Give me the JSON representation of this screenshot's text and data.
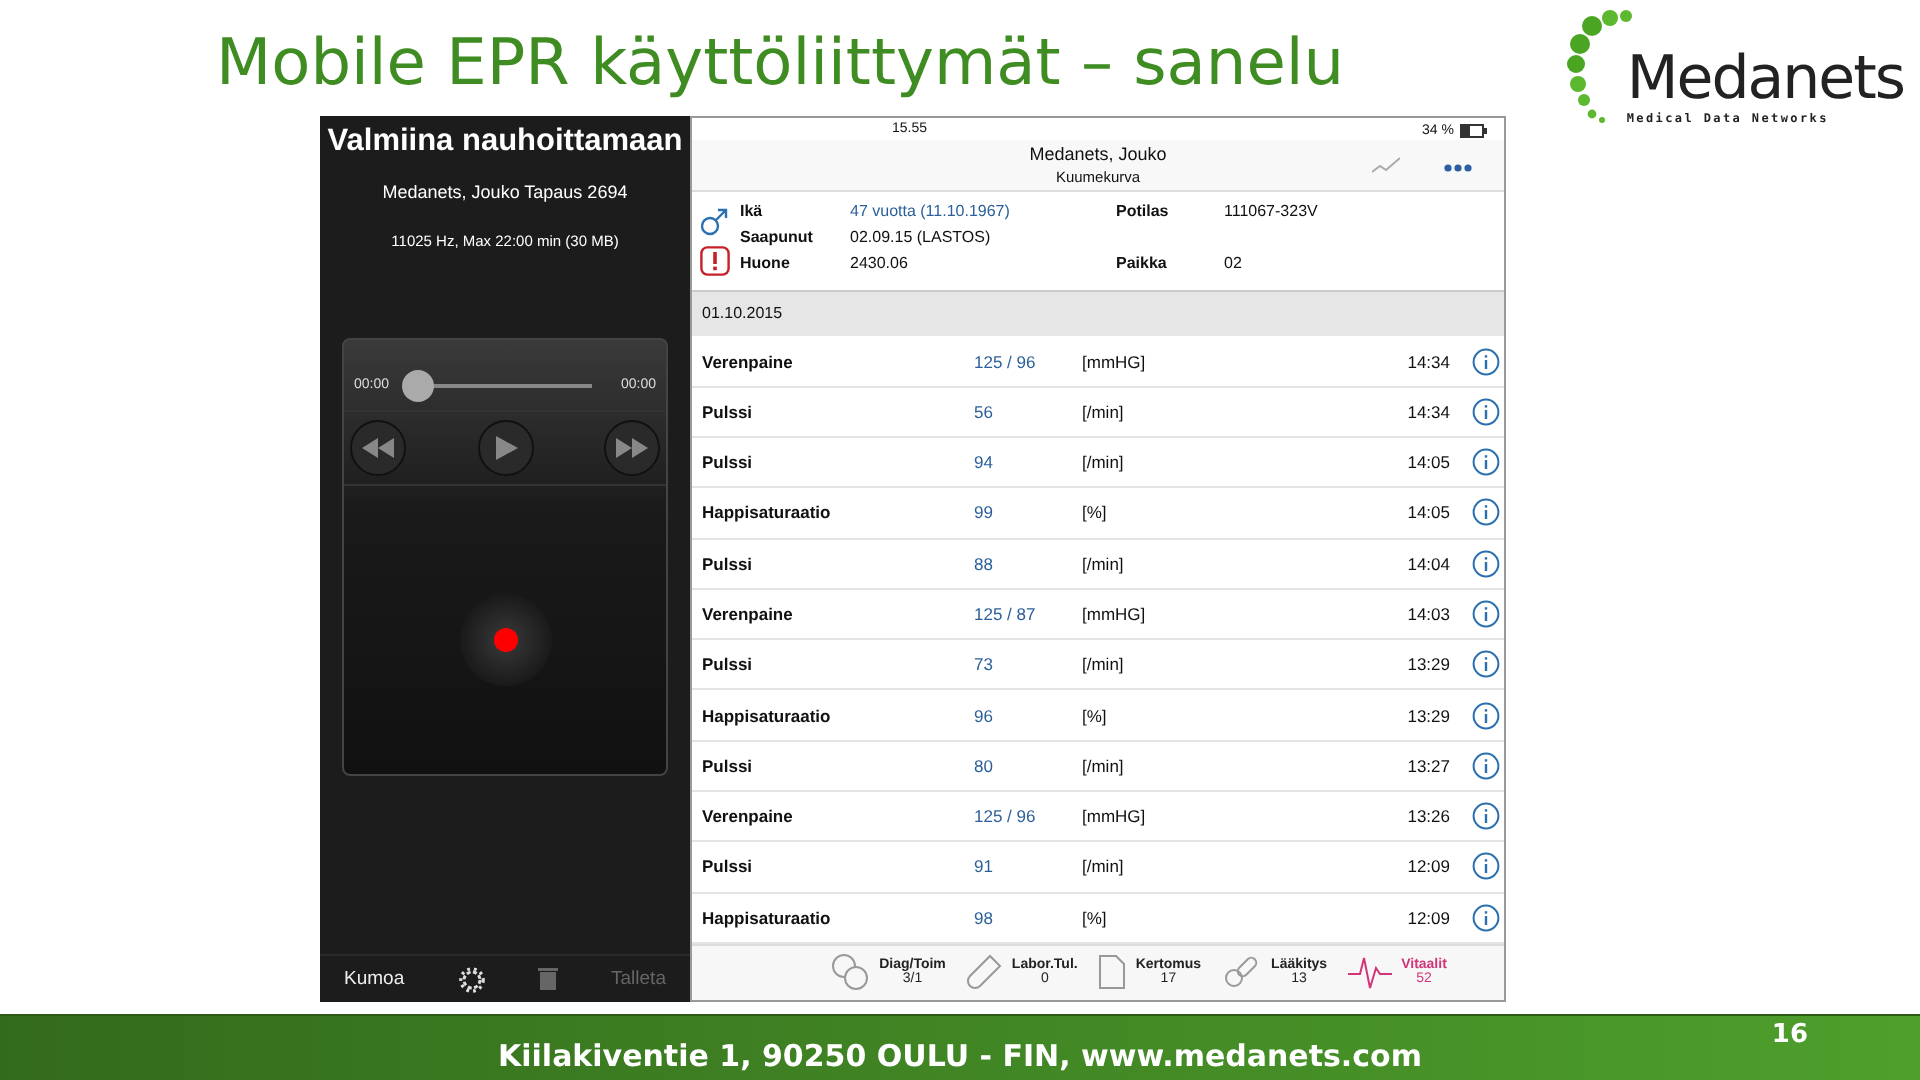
{
  "slide": {
    "title": "Mobile EPR käyttöliittymät – sanelu",
    "logo": {
      "name": "Medanets",
      "tagline": "Medical Data Networks"
    },
    "footer": "Kiilakiventie 1, 90250 OULU - FIN, www.medanets.com",
    "page_number": "16"
  },
  "recorder": {
    "title": "Valmiina nauhoittamaan",
    "patient": "Medanets, Jouko Tapaus 2694",
    "info": "11025 Hz, Max 22:00 min (30 MB)",
    "player": {
      "elapsed": "00:00",
      "total": "00:00",
      "level": 0
    },
    "toolbar": [
      {
        "kind": "text",
        "label": "Kumoa",
        "disabled": false
      },
      {
        "kind": "gear",
        "disabled": false
      },
      {
        "kind": "trash",
        "disabled": true
      },
      {
        "kind": "text",
        "label": "Talleta",
        "disabled": true
      }
    ]
  },
  "record": {
    "status_bar": {
      "time": "15.55",
      "battery": "34 %"
    },
    "header": {
      "title": "Medanets, Jouko",
      "subtitle": "Kuumekurva"
    },
    "patient": [
      {
        "label": "Ikä",
        "value": "47 vuotta (11.10.1967)",
        "link": true
      },
      {
        "label": "Saapunut",
        "value": "02.09.15 (LASTOS)",
        "link": false
      },
      {
        "label": "Huone",
        "value": "2430.06",
        "link": false
      }
    ],
    "patient_right": [
      {
        "label": "Potilas",
        "value": "111067-323V"
      },
      {
        "label": "Paikka",
        "value": "02"
      }
    ],
    "date": "01.10.2015",
    "rows": [
      {
        "name": "Verenpaine",
        "value": "125 / 96",
        "unit": "[mmHG]",
        "time": "14:34"
      },
      {
        "name": "Pulssi",
        "value": "56",
        "unit": "[/min]",
        "time": "14:34"
      },
      {
        "name": "Pulssi",
        "value": "94",
        "unit": "[/min]",
        "time": "14:05"
      },
      {
        "name": "Happisaturaatio",
        "value": "99",
        "unit": "[%]",
        "time": "14:05"
      },
      {
        "name": "Pulssi",
        "value": "88",
        "unit": "[/min]",
        "time": "14:04"
      },
      {
        "name": "Verenpaine",
        "value": "125 / 87",
        "unit": "[mmHG]",
        "time": "14:03"
      },
      {
        "name": "Pulssi",
        "value": "73",
        "unit": "[/min]",
        "time": "13:29"
      },
      {
        "name": "Happisaturaatio",
        "value": "96",
        "unit": "[%]",
        "time": "13:29"
      },
      {
        "name": "Pulssi",
        "value": "80",
        "unit": "[/min]",
        "time": "13:27"
      },
      {
        "name": "Verenpaine",
        "value": "125 / 96",
        "unit": "[mmHG]",
        "time": "13:26"
      },
      {
        "name": "Pulssi",
        "value": "91",
        "unit": "[/min]",
        "time": "12:09"
      },
      {
        "name": "Happisaturaatio",
        "value": "98",
        "unit": "[%]",
        "time": "12:09"
      }
    ],
    "tabs": [
      {
        "kind": "dv",
        "label": "Diag/Toim",
        "count": "3/1",
        "selected": false
      },
      {
        "kind": "tube",
        "label": "Labor.Tul.",
        "count": "0",
        "selected": false
      },
      {
        "kind": "doc",
        "label": "Kertomus",
        "count": "17",
        "selected": false
      },
      {
        "kind": "pills",
        "label": "Lääkitys",
        "count": "13",
        "selected": false
      },
      {
        "kind": "pulse",
        "label": "Vitaalit",
        "count": "52",
        "selected": true
      }
    ]
  }
}
